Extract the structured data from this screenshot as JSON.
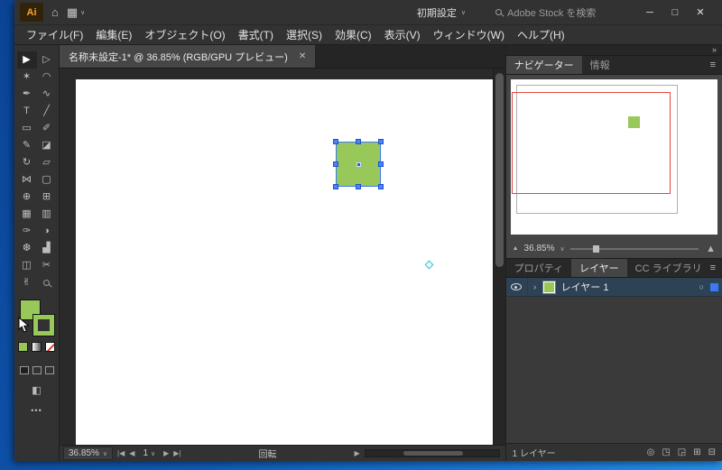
{
  "colors": {
    "artwork_green": "#98c859",
    "selection_blue": "#3a78f2",
    "navigator_view_red": "#e0483c",
    "panel_bg": "#323232",
    "desktop_blue": "#1a78da"
  },
  "icons": {
    "home": "⌂",
    "workspace_grid": "▦",
    "caret_down": "∨",
    "minimize": "─",
    "maximize": "□",
    "close": "✕",
    "tab_close": "✕",
    "panel_menu": "≡",
    "collapse": "»",
    "layer_expand": "›",
    "target_circle": "○",
    "nav_first": "|◀",
    "nav_prev": "◀",
    "nav_next": "▶",
    "nav_last": "▶|",
    "status_popup": "▶",
    "zoom_out_mountain": "▲",
    "zoom_in_mountain": "▲",
    "screen_mode": "◧",
    "ellipsis": "•••",
    "locate_object": "◎",
    "clipping_mask": "◳",
    "new_sublayer": "◲",
    "new_layer": "⊞",
    "delete_layer": "⊟"
  },
  "titlebar": {
    "logo": "Ai",
    "workspace": "初期設定",
    "search_placeholder": "Adobe Stock を検索"
  },
  "menubar": {
    "items": [
      {
        "label": "ファイル(F)"
      },
      {
        "label": "編集(E)"
      },
      {
        "label": "オブジェクト(O)"
      },
      {
        "label": "書式(T)"
      },
      {
        "label": "選択(S)"
      },
      {
        "label": "効果(C)"
      },
      {
        "label": "表示(V)"
      },
      {
        "label": "ウィンドウ(W)"
      },
      {
        "label": "ヘルプ(H)"
      }
    ]
  },
  "toolbar": {
    "tools": [
      {
        "name": "selection-tool",
        "glyph": "▶"
      },
      {
        "name": "direct-selection-tool",
        "glyph": "▷"
      },
      {
        "name": "magic-wand-tool",
        "glyph": "✶"
      },
      {
        "name": "lasso-tool",
        "glyph": "◠"
      },
      {
        "name": "pen-tool",
        "glyph": "✒"
      },
      {
        "name": "curvature-tool",
        "glyph": "∿"
      },
      {
        "name": "type-tool",
        "glyph": "T"
      },
      {
        "name": "line-segment-tool",
        "glyph": "╱"
      },
      {
        "name": "rectangle-tool",
        "glyph": "▭"
      },
      {
        "name": "paintbrush-tool",
        "glyph": "✐"
      },
      {
        "name": "pencil-tool",
        "glyph": "✎"
      },
      {
        "name": "eraser-tool",
        "glyph": "◪"
      },
      {
        "name": "rotate-tool",
        "glyph": "↻"
      },
      {
        "name": "scale-tool",
        "glyph": "▱"
      },
      {
        "name": "width-tool",
        "glyph": "⋈"
      },
      {
        "name": "free-transform-tool",
        "glyph": "▢"
      },
      {
        "name": "shape-builder-tool",
        "glyph": "⊕"
      },
      {
        "name": "perspective-grid-tool",
        "glyph": "⊞"
      },
      {
        "name": "mesh-tool",
        "glyph": "▦"
      },
      {
        "name": "gradient-tool",
        "glyph": "▥"
      },
      {
        "name": "eyedropper-tool",
        "glyph": "✑"
      },
      {
        "name": "blend-tool",
        "glyph": "◑"
      },
      {
        "name": "symbol-sprayer-tool",
        "glyph": "❆"
      },
      {
        "name": "column-graph-tool",
        "glyph": "▟"
      },
      {
        "name": "artboard-tool",
        "glyph": "◫"
      },
      {
        "name": "slice-tool",
        "glyph": "✂"
      },
      {
        "name": "hand-tool",
        "glyph": "✌"
      },
      {
        "name": "zoom-tool",
        "glyph": ""
      }
    ],
    "fill_color": "#98c859",
    "stroke_color": "#98c859"
  },
  "document": {
    "tab_title": "名称未設定-1* @ 36.85% (RGB/GPU プレビュー)",
    "zoom": "36.85%",
    "artboard_number": "1",
    "status": "回転"
  },
  "navigator": {
    "tab_navigator": "ナビゲーター",
    "tab_info": "情報",
    "zoom": "36.85%"
  },
  "panels": {
    "tab_properties": "プロパティ",
    "tab_layers": "レイヤー",
    "tab_cc": "CC ライブラリ"
  },
  "layers": {
    "items": [
      {
        "name": "レイヤー 1"
      }
    ],
    "count": "1 レイヤー"
  }
}
